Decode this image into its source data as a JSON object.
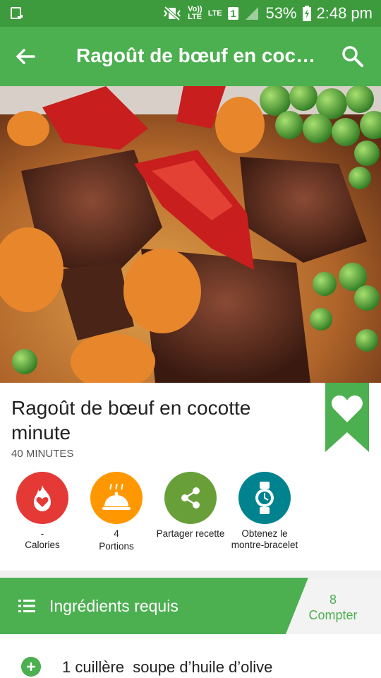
{
  "status_bar": {
    "volte_label": "Vo))\nLTE",
    "lte_label": "LTE",
    "sim_label": "1",
    "battery_percent": "53%",
    "time": "2:48 pm"
  },
  "app_bar": {
    "title": "Ragoût de bœuf en coc…"
  },
  "recipe": {
    "title": "Ragoût de bœuf en cocotte minute",
    "duration": "40 MINUTES"
  },
  "actions": [
    {
      "value": "-",
      "label": "Calories",
      "color": "#e53935"
    },
    {
      "value": "4",
      "label": "Portions",
      "color": "#ff9800"
    },
    {
      "label": "Partager recette",
      "color": "#689f38"
    },
    {
      "label": "Obtenez le montre-bracelet",
      "color": "#00838f"
    }
  ],
  "ingredients_bar": {
    "label": "Ingrédients requis",
    "count": "8",
    "count_label": "Compter"
  },
  "ingredients": [
    {
      "text": "1 cuillère  soupe d’huile d’olive"
    }
  ],
  "colors": {
    "primary": "#4caf50",
    "primary_dark": "#3d9b3d"
  }
}
